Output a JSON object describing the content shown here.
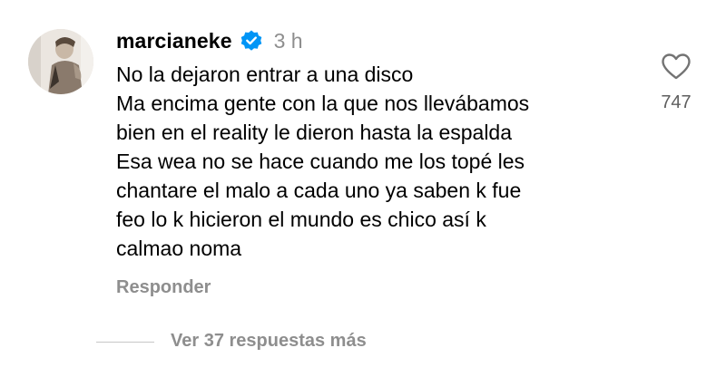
{
  "comment": {
    "username": "marcianeke",
    "verified_icon": "verified-badge-icon",
    "time": "3 h",
    "lines": [
      "No la dejaron entrar a una disco",
      "Ma encima gente con la que nos llevábamos",
      "bien en el reality le dieron hasta la espalda",
      "Esa wea no se hace cuando me los topé les",
      "chantare el malo a cada uno ya saben k fue",
      "feo lo k hicieron el mundo es chico así k",
      "calmao noma"
    ],
    "reply_label": "Responder",
    "like_icon": "heart-icon",
    "like_count": "747",
    "more_replies_label": "Ver 37 respuestas más"
  },
  "colors": {
    "text": "#000000",
    "secondary": "#8e8e8e",
    "verified": "#0095f6",
    "background": "#ffffff"
  }
}
